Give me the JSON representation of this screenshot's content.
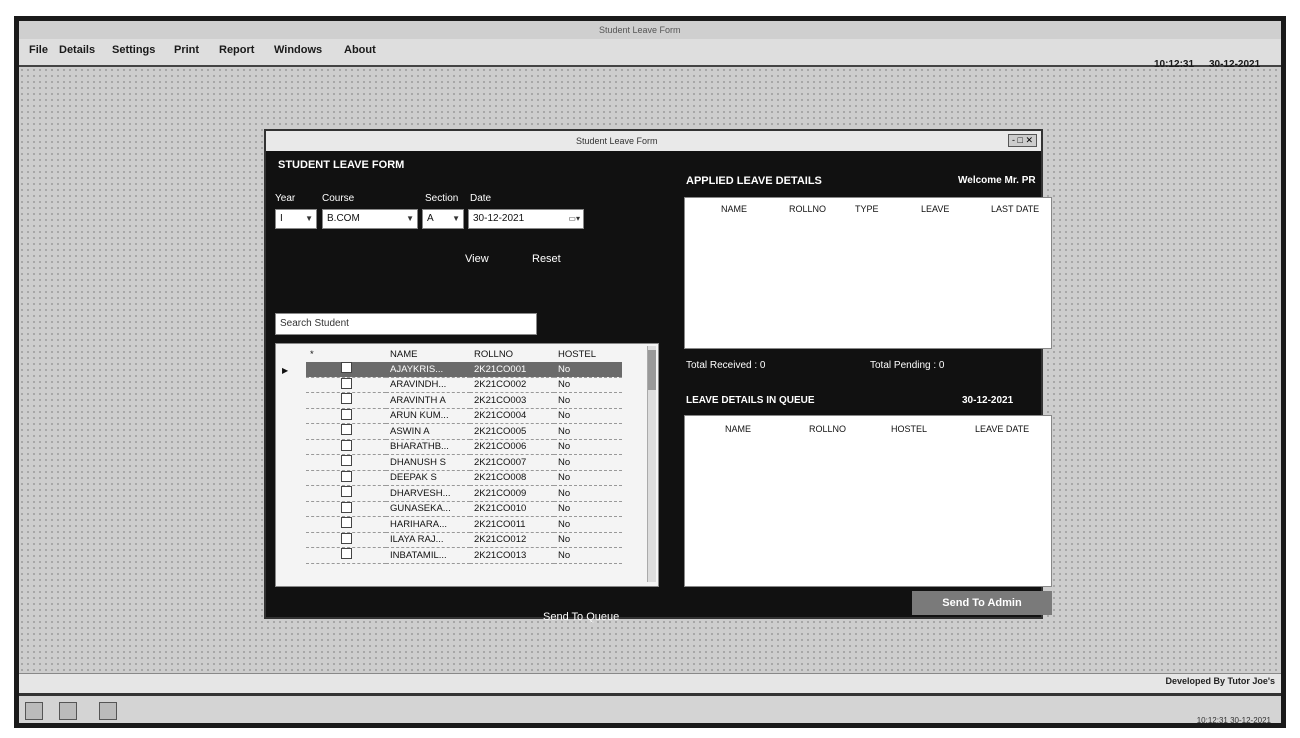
{
  "app": {
    "title": "Student Leave Form",
    "menu": [
      "File",
      "Details",
      "Settings",
      "Print",
      "Report",
      "Windows",
      "About"
    ],
    "time": "10:12:31",
    "date": "30-12-2021",
    "developed_by": "Developed By Tutor Joe's"
  },
  "form": {
    "window_title": "Student Leave Form",
    "window_buttons": "-  □  ✕",
    "left": {
      "title": "STUDENT LEAVE FORM",
      "labels": {
        "year": "Year",
        "course": "Course",
        "section": "Section",
        "date": "Date"
      },
      "values": {
        "year": "I",
        "course": "B.COM",
        "section": "A",
        "date": "30-12-2021"
      },
      "view_button": "View",
      "reset_button": "Reset",
      "search_placeholder": "Search Student",
      "grid_columns": [
        "",
        "NAME",
        "ROLLNO",
        "HOSTEL"
      ],
      "select_all_symbol": "*",
      "rows": [
        {
          "name": "AJAYKRIS...",
          "rollno": "2K21CO001",
          "hostel": "No"
        },
        {
          "name": "ARAVINDH...",
          "rollno": "2K21CO002",
          "hostel": "No"
        },
        {
          "name": "ARAVINTH A",
          "rollno": "2K21CO003",
          "hostel": "No"
        },
        {
          "name": "ARUN KUM...",
          "rollno": "2K21CO004",
          "hostel": "No"
        },
        {
          "name": "ASWIN A",
          "rollno": "2K21CO005",
          "hostel": "No"
        },
        {
          "name": "BHARATHB...",
          "rollno": "2K21CO006",
          "hostel": "No"
        },
        {
          "name": "DHANUSH S",
          "rollno": "2K21CO007",
          "hostel": "No"
        },
        {
          "name": "DEEPAK S",
          "rollno": "2K21CO008",
          "hostel": "No"
        },
        {
          "name": "DHARVESH...",
          "rollno": "2K21CO009",
          "hostel": "No"
        },
        {
          "name": "GUNASEKA...",
          "rollno": "2K21CO010",
          "hostel": "No"
        },
        {
          "name": "HARIHARA...",
          "rollno": "2K21CO011",
          "hostel": "No"
        },
        {
          "name": "ILAYA RAJ...",
          "rollno": "2K21CO012",
          "hostel": "No"
        },
        {
          "name": "INBATAMIL...",
          "rollno": "2K21CO013",
          "hostel": "No"
        }
      ],
      "selected_row": 0,
      "send_queue_button": "Send To Queue"
    },
    "right": {
      "applied_title": "APPLIED LEAVE DETAILS",
      "welcome": "Welcome Mr. PR",
      "applied_columns": [
        "NAME",
        "ROLLNO",
        "TYPE",
        "LEAVE",
        "LAST DATE"
      ],
      "total_received": "Total Received : 0",
      "total_pending": "Total Pending : 0",
      "queue_title": "LEAVE DETAILS IN QUEUE",
      "queue_date": "30-12-2021",
      "queue_columns": [
        "NAME",
        "ROLLNO",
        "HOSTEL",
        "LEAVE DATE"
      ],
      "send_admin_button": "Send To Admin"
    }
  },
  "colors": {
    "panel": "#111111",
    "desktop": "#cdcdcd",
    "selected_row": "#6a6a6a"
  }
}
